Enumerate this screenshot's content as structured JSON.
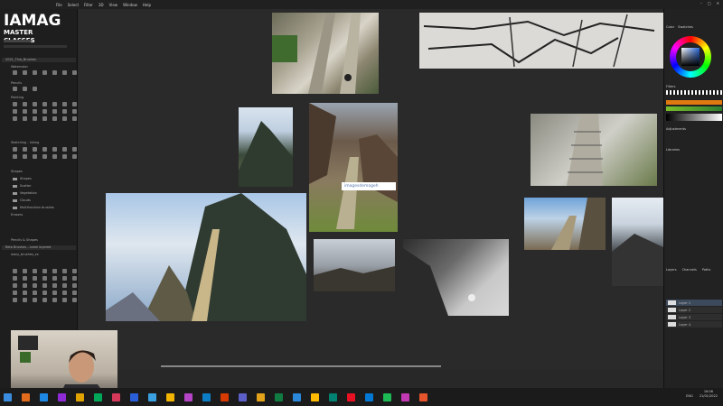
{
  "logo": {
    "line1": "IAMAG",
    "line2": "MASTER CLASSES"
  },
  "menu": [
    "File",
    "Select",
    "Filter",
    "3D",
    "View",
    "Window",
    "Help"
  ],
  "left_panel": {
    "sections": [
      "2021_Tina_Brushes",
      "Watercolor",
      "Pencils",
      "Painting",
      "Sketching - Inking",
      "Shapes",
      "Erasers",
      "Pencils & Shapes",
      "Reto Brushes - Leam layered",
      "wavy_brushes_xx"
    ],
    "folders": [
      "Shapes",
      "Scatter",
      "Vegetation",
      "Clouds",
      "Multifunction brushes"
    ],
    "stroke_label": "Layer"
  },
  "right_panel": {
    "tabs": [
      "Color",
      "Swatches"
    ],
    "panels": [
      "Filters",
      "Adjustments",
      "Libraries",
      "Layers",
      "Channels",
      "Paths"
    ],
    "layers": [
      "Layer 1",
      "Layer 2",
      "Layer 3",
      "Layer 4"
    ]
  },
  "watermark": "imagesdemageh",
  "tray": {
    "lang": "ENG",
    "time": "16:06",
    "date": "21/01/2022"
  },
  "taskbar_icon_colors": [
    "#e06c1c",
    "#1e88e5",
    "#8e2bd6",
    "#e0a300",
    "#00a85a",
    "#d6385a",
    "#2b5fd9",
    "#3aa0e0",
    "#f2b400",
    "#b544c7",
    "#0c7dc4",
    "#d83b01",
    "#5b5fc7",
    "#e3a21a",
    "#107c41",
    "#2b88d8",
    "#ffb900",
    "#008272",
    "#e81123",
    "#0078d4",
    "#1db954",
    "#c239b3",
    "#e5542c"
  ]
}
